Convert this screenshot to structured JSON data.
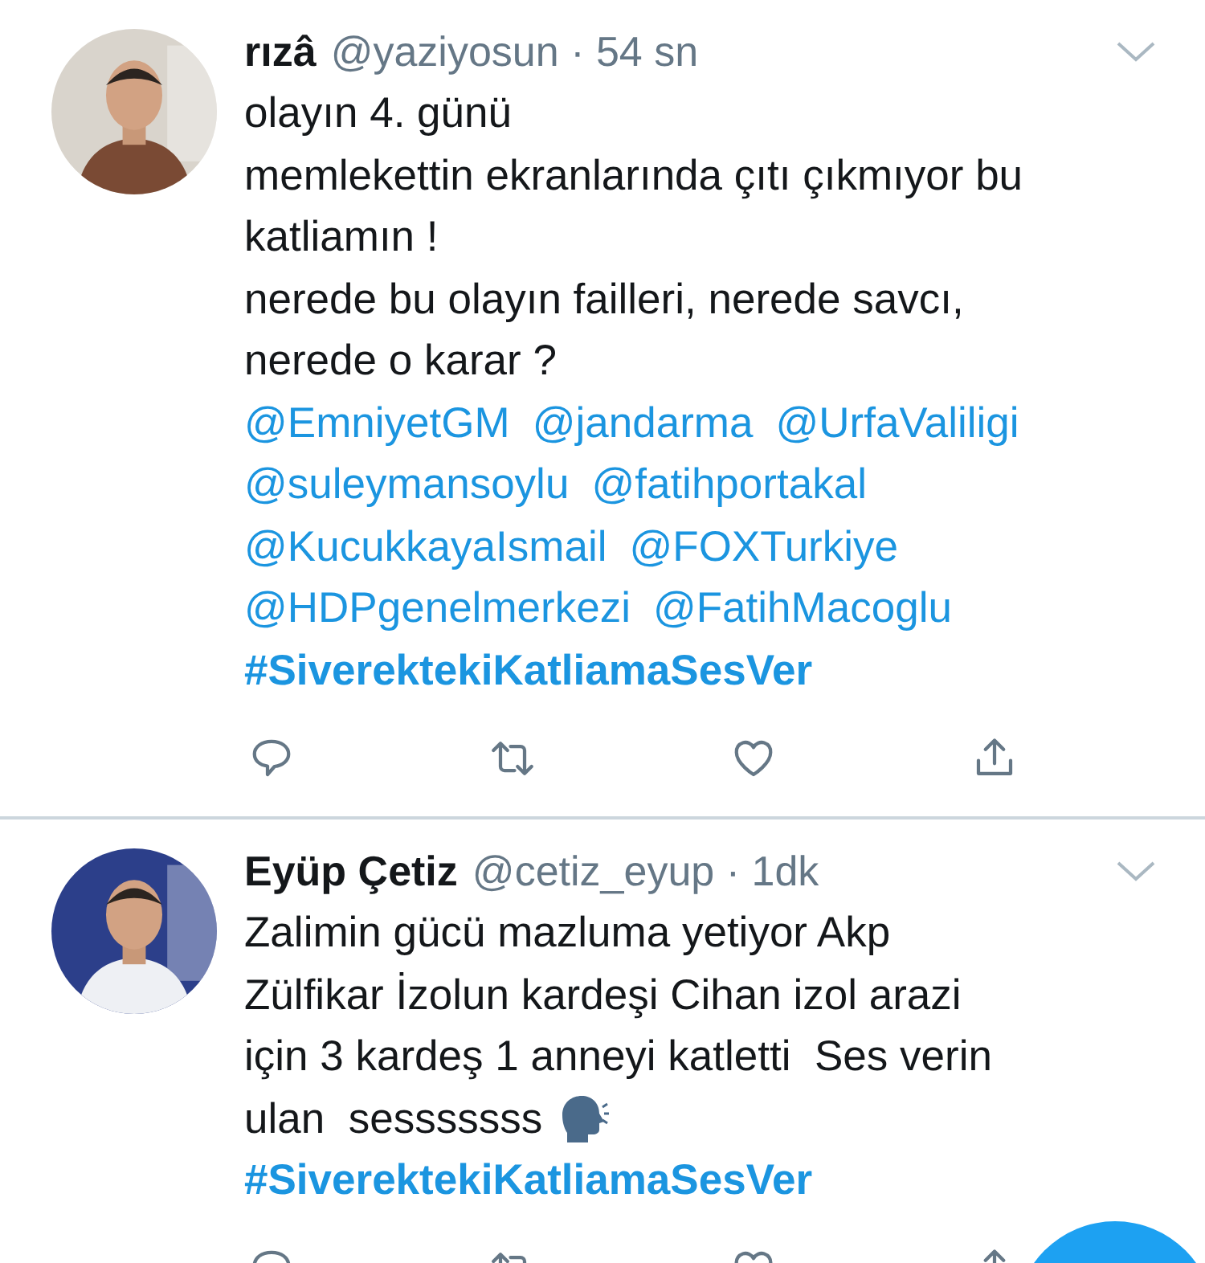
{
  "tweets": [
    {
      "name": "rızâ",
      "handle": "@yaziyosun",
      "separator": "·",
      "time": "54 sn",
      "avatar": {
        "kind": "picture"
      },
      "lines": [
        {
          "kind": "text",
          "text": "olayın 4. günü"
        },
        {
          "kind": "text",
          "text": "memlekettin ekranlarında çıtı çıkmıyor bu"
        },
        {
          "kind": "text",
          "text": "katliamın !"
        },
        {
          "kind": "text",
          "text": "nerede bu olayın failleri, nerede savcı,"
        },
        {
          "kind": "text",
          "text": "nerede o karar ?"
        },
        {
          "kind": "links",
          "links": [
            "@EmniyetGM",
            "@jandarma",
            "@UrfaValiligi"
          ]
        },
        {
          "kind": "links",
          "links": [
            "@suleymansoylu",
            "@fatihportakal"
          ]
        },
        {
          "kind": "links",
          "links": [
            "@KucukkayaIsmail",
            "@FOXTurkiye"
          ]
        },
        {
          "kind": "links",
          "links": [
            "@HDPgenelmerkezi",
            "@FatihMacoglu"
          ]
        },
        {
          "kind": "hashtag",
          "text": "#SiverektekiKatliamaSesVer"
        }
      ],
      "actions": [
        {
          "kind": "reply"
        },
        {
          "kind": "retweet"
        },
        {
          "kind": "like"
        },
        {
          "kind": "share"
        }
      ]
    },
    {
      "name": "Eyüp Çetiz",
      "handle": "@cetiz_eyup",
      "separator": "·",
      "time": "1dk",
      "avatar": {
        "kind": "picture"
      },
      "lines": [
        {
          "kind": "text",
          "text": "Zalimin gücü mazluma yetiyor Akp"
        },
        {
          "kind": "text",
          "text": "Zülfikar İzolun kardeşi Cihan izol arazi"
        },
        {
          "kind": "text",
          "text": "için 3 kardeş 1 anneyi katletti  Ses verin"
        },
        {
          "kind": "speech",
          "text": "ulan  sesssssss"
        },
        {
          "kind": "hashtag",
          "text": "#SiverektekiKatliamaSesVer"
        }
      ],
      "actions": [
        {
          "kind": "reply"
        },
        {
          "kind": "retweet"
        },
        {
          "kind": "like"
        },
        {
          "kind": "share"
        }
      ]
    }
  ]
}
